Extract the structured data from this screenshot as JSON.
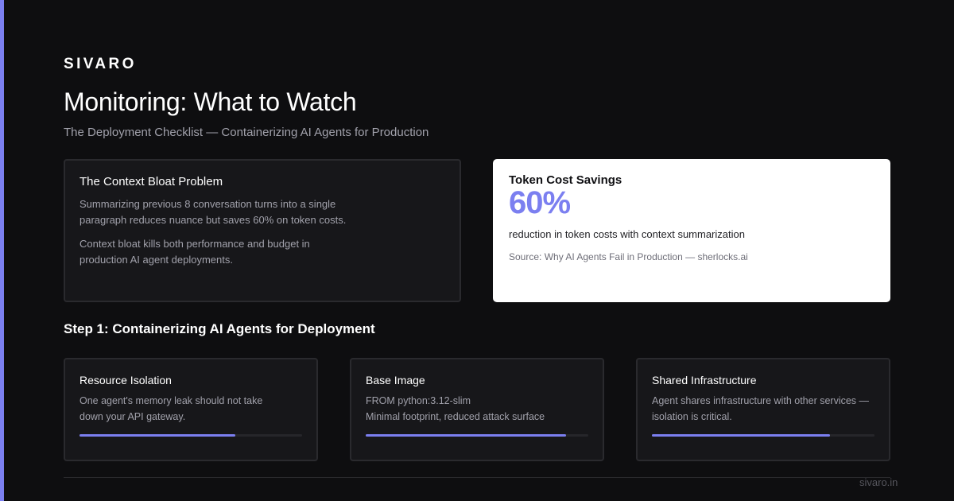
{
  "brand": "SIVARO",
  "title": "Monitoring: What to Watch",
  "subtitle": "The Deployment Checklist — Containerizing AI Agents for Production",
  "context_card": {
    "heading": "The Context Bloat Problem",
    "paragraphs": [
      "Summarizing previous 8 conversation turns into a single paragraph reduces nuance but saves 60% on token costs.",
      "Context bloat kills both performance and budget in production AI agent deployments."
    ]
  },
  "stat_card": {
    "heading": "Token Cost Savings",
    "value": "60%",
    "description": "reduction in token costs with context summarization",
    "source": "Source: Why AI Agents Fail in Production — sherlocks.ai"
  },
  "section_heading": "Step 1: Containerizing AI Agents for Deployment",
  "steps": [
    {
      "title": "Resource Isolation",
      "lines": [
        "One agent's memory leak should not take down your API gateway."
      ],
      "progress": 0.7
    },
    {
      "title": "Base Image",
      "lines": [
        "FROM python:3.12-slim",
        "Minimal footprint, reduced attack surface"
      ],
      "progress": 0.9
    },
    {
      "title": "Shared Infrastructure",
      "lines": [
        "Agent shares infrastructure with other services — isolation is critical."
      ],
      "progress": 0.8
    }
  ],
  "footer_url": "sivaro.in",
  "colors": {
    "accent": "#7b7ff0",
    "background": "#0e0e10",
    "card": "#17171a"
  }
}
